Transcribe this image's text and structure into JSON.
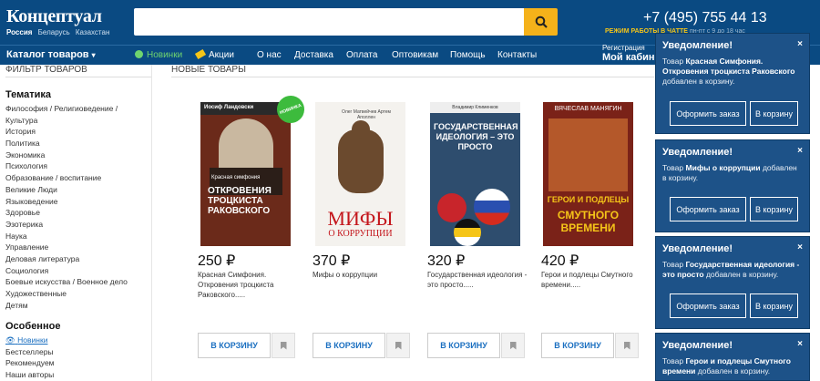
{
  "header": {
    "logo": "Концептуал",
    "regions": [
      "Россия",
      "Беларусь",
      "Казахстан"
    ],
    "search_placeholder": "",
    "phone": "+7 (495) 755 44 13",
    "mode_label": "РЕЖИМ РАБОТЫ В ЧАТТЕ",
    "mode_hours": "пн-пт с 9 до 18 час"
  },
  "nav": {
    "catalog": "Каталог товаров",
    "items": [
      "Новинки",
      "Акции",
      "О нас",
      "Доставка",
      "Оплата",
      "Оптовикам",
      "Помощь",
      "Контакты"
    ],
    "register": "Регистрация",
    "cabinet": "Мой кабинет"
  },
  "sidebar": {
    "filter": "ФИЛЬТР ТОВАРОВ",
    "theme": "Тематика",
    "categories": [
      "Философия / Религиоведение /",
      "Культура",
      "История",
      "Политика",
      "Экономика",
      "Психология",
      "Образование / воспитание",
      "Великие Люди",
      "Языковедение",
      "Здоровье",
      "Эзотерика",
      "Наука",
      "Управление",
      "Деловая литература",
      "Социология",
      "Боевые искусства / Военное дело",
      "Художественные",
      "Детям"
    ],
    "special": "Особенное",
    "special_items": [
      "Новинки",
      "Бестселлеры",
      "Рекомендуем",
      "Наши авторы"
    ]
  },
  "main": {
    "new_title": "НОВЫЕ ТОВАРЫ",
    "badge": "НОВИНКА",
    "buy": "В КОРЗИНУ",
    "products": [
      {
        "price": "250 ₽",
        "title": "Красная Симфония. Откровения троцкиста Раковского.....",
        "cover_author": "Иосиф Ландовски",
        "cover_small": "Красная симфония",
        "cover_title": "Откровения троцкиста Раковского"
      },
      {
        "price": "370 ₽",
        "title": "Мифы о коррупции",
        "cover_author": "Олег Матвейчев  Артем Аполлен",
        "cover_title": "МИФЫ",
        "cover_sub": "О КОРРУПЦИИ"
      },
      {
        "price": "320 ₽",
        "title": "Государственная идеология - это просто.....",
        "cover_author": "Владимир Клименков",
        "cover_title": "ГОСУДАРСТВЕННАЯ ИДЕОЛОГИЯ – ЭТО ПРОСТО"
      },
      {
        "price": "420 ₽",
        "title": "Герои и подлецы Смутного времени.....",
        "cover_author": "ВЯЧЕСЛАВ МАНЯГИН",
        "cover_title": "ГЕРОИ И ПОДЛЕЦЫ",
        "cover_sub": "СМУТНОГО ВРЕМЕНИ"
      }
    ]
  },
  "notifications": {
    "title": "Уведомление!",
    "close": "×",
    "order": "Оформить заказ",
    "cart": "В корзину",
    "prefix": "Товар",
    "suffix": "добавлен в корзину.",
    "items": [
      "Красная Симфония. Откровения троцкиста Раковского",
      "Мифы о коррупции",
      "Государственная идеология - это просто",
      "Герои и подлецы Смутного времени"
    ]
  },
  "colors": {
    "header": "#0a4a82",
    "accent": "#f5b21a",
    "notif": "#1d5288",
    "link": "#1a6fc0"
  }
}
